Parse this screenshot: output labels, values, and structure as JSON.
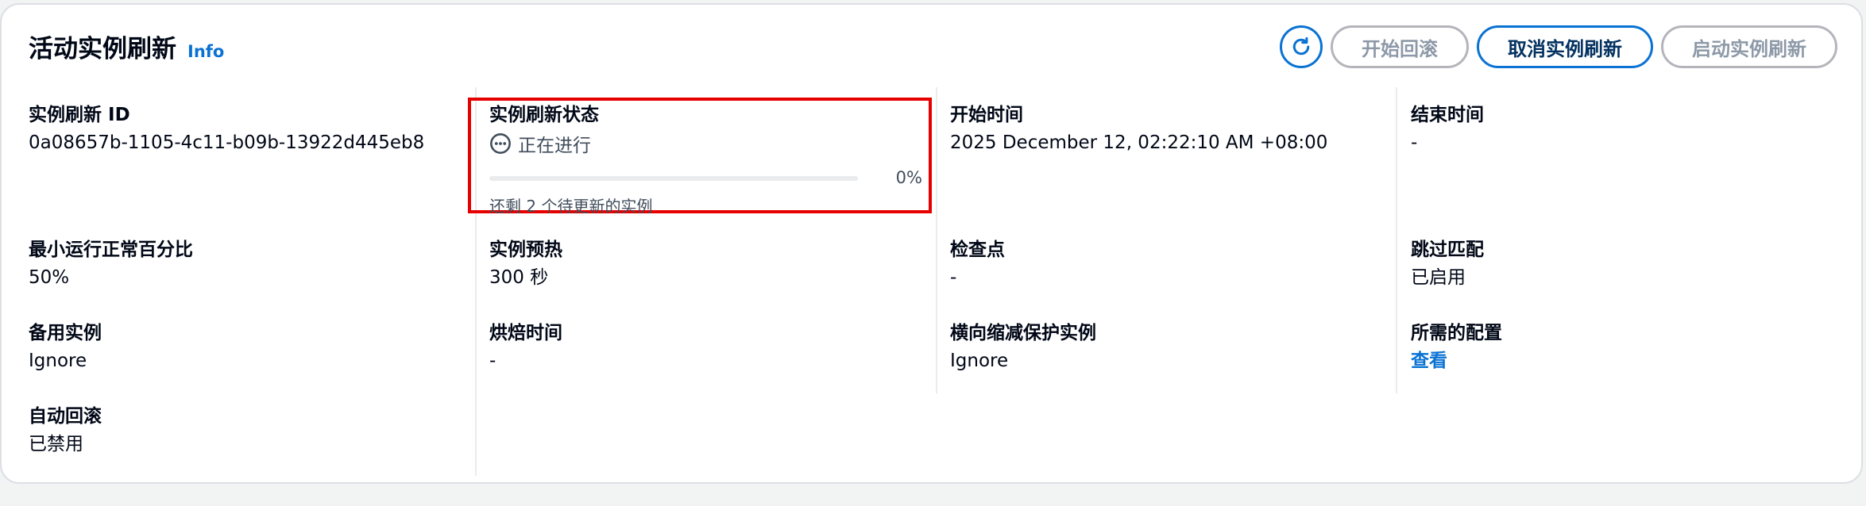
{
  "header": {
    "title": "活动实例刷新",
    "info_label": "Info"
  },
  "actions": {
    "refresh_icon": "refresh-icon",
    "start_rollback": "开始回滚",
    "cancel_refresh": "取消实例刷新",
    "start_refresh": "启动实例刷新"
  },
  "fields": {
    "refresh_id": {
      "label": "实例刷新 ID",
      "value": "0a08657b-1105-4c11-b09b-13922d445eb8"
    },
    "status": {
      "label": "实例刷新状态",
      "value": "正在进行",
      "icon": "in-progress-icon",
      "progress_percent": 0,
      "progress_label": "0%",
      "progress_description": "还剩 2 个待更新的实例"
    },
    "start_time": {
      "label": "开始时间",
      "value": "2025 December 12, 02:22:10 AM +08:00"
    },
    "end_time": {
      "label": "结束时间",
      "value": "-"
    },
    "min_healthy": {
      "label": "最小运行正常百分比",
      "value": "50%"
    },
    "warmup": {
      "label": "实例预热",
      "value": "300 秒"
    },
    "checkpoint": {
      "label": "检查点",
      "value": "-"
    },
    "skip_matching": {
      "label": "跳过匹配",
      "value": "已启用"
    },
    "standby": {
      "label": "备用实例",
      "value": "Ignore"
    },
    "bake_time": {
      "label": "烘焙时间",
      "value": "-"
    },
    "scale_in_protect": {
      "label": "横向缩减保护实例",
      "value": "Ignore"
    },
    "desired_config": {
      "label": "所需的配置",
      "value": "查看"
    },
    "auto_rollback": {
      "label": "自动回滚",
      "value": "已禁用"
    }
  },
  "colors": {
    "accent": "#0972d3",
    "highlight_border": "#e60000",
    "disabled_border": "#b4b4bb"
  }
}
